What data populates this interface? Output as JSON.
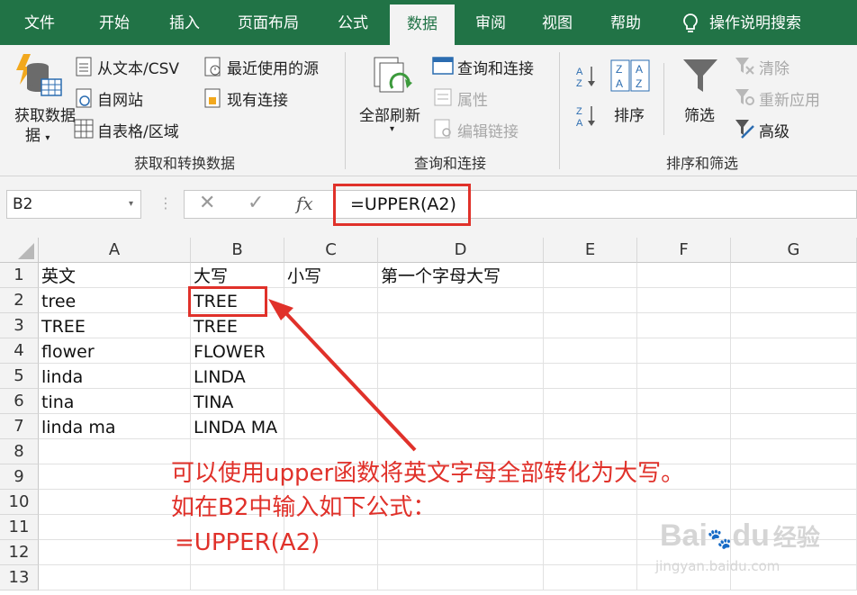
{
  "ribbon_tabs": [
    "文件",
    "开始",
    "插入",
    "页面布局",
    "公式",
    "数据",
    "审阅",
    "视图",
    "帮助"
  ],
  "active_tab": "数据",
  "tell_me": "操作说明搜索",
  "groups": {
    "get_data": {
      "big_button": "获取数据",
      "big_button_sub": "据",
      "from_text": "从文本/CSV",
      "from_web": "自网站",
      "from_table": "自表格/区域",
      "recent_sources": "最近使用的源",
      "existing_conn": "现有连接",
      "label": "获取和转换数据"
    },
    "queries": {
      "refresh_all": "全部刷新",
      "queries_conn": "查询和连接",
      "properties": "属性",
      "edit_links": "编辑链接",
      "label": "查询和连接"
    },
    "sort_filter": {
      "sort": "排序",
      "filter": "筛选",
      "clear": "清除",
      "reapply": "重新应用",
      "advanced": "高级",
      "label": "排序和筛选"
    }
  },
  "formula_bar": {
    "name_box": "B2",
    "fx": "fx",
    "formula": "=UPPER(A2)"
  },
  "sheet": {
    "columns": [
      "A",
      "B",
      "C",
      "D",
      "E",
      "F",
      "G"
    ],
    "rows": [
      "1",
      "2",
      "3",
      "4",
      "5",
      "6",
      "7",
      "8",
      "9",
      "10",
      "11",
      "12",
      "13"
    ],
    "cells": {
      "A1": "英文",
      "B1": "大写",
      "C1": "小写",
      "D1": "第一个字母大写",
      "A2": "tree",
      "B2": "TREE",
      "A3": "TREE",
      "B3": "TREE",
      "A4": "flower",
      "B4": "FLOWER",
      "A5": "linda",
      "B5": "LINDA",
      "A6": "tina",
      "B6": "TINA",
      "A7": "linda ma",
      "B7": "LINDA MA"
    }
  },
  "annotation": {
    "line1": "可以使用upper函数将英文字母全部转化为大写。",
    "line2": "如在B2中输入如下公式：",
    "line3": "=UPPER(A2)",
    "color": "#e0312a"
  },
  "watermark": {
    "brand": "Bai",
    "brand2": "du",
    "cn": "经验",
    "url": "jingyan.baidu.com"
  }
}
